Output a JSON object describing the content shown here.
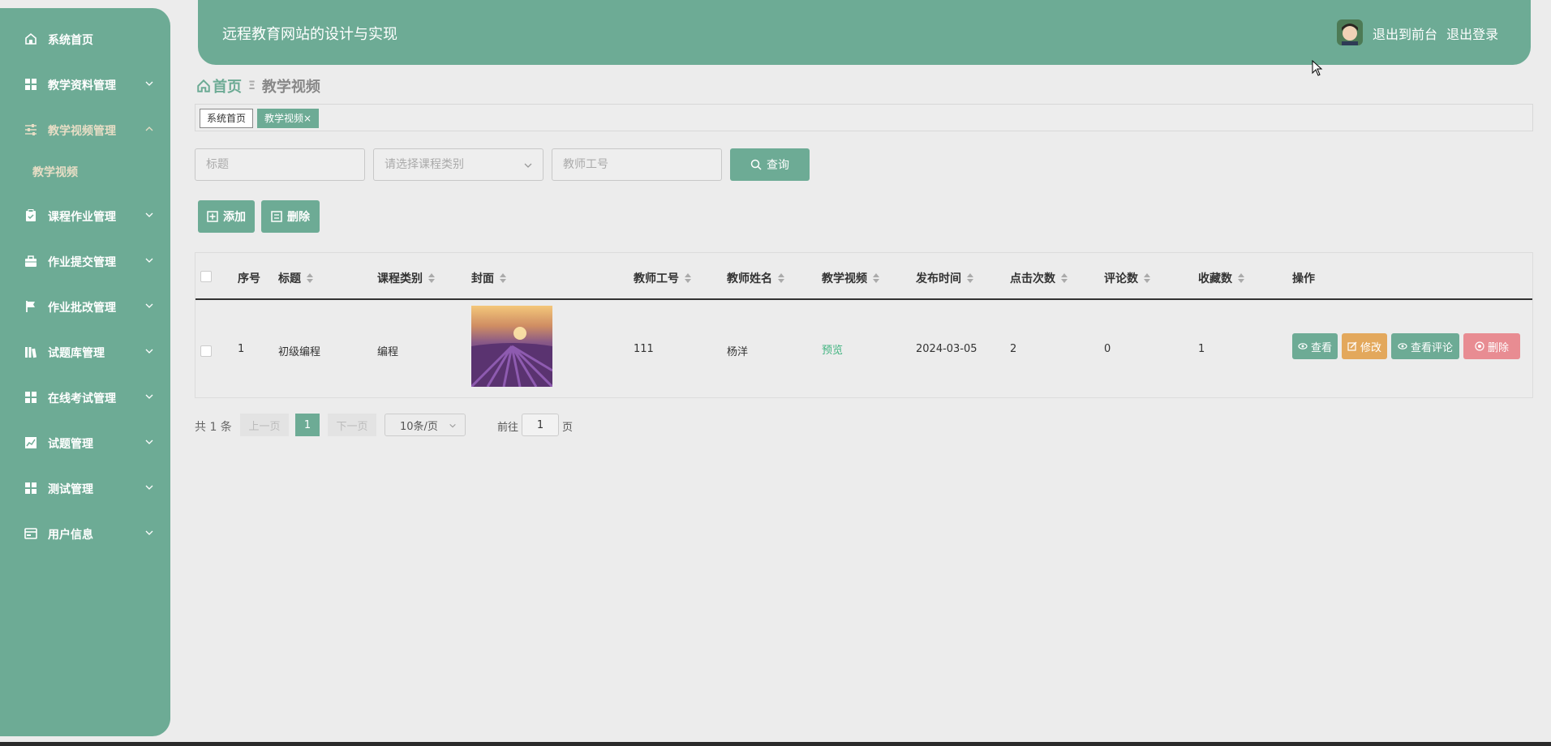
{
  "sidebar": {
    "items": [
      {
        "label": "系统首页",
        "icon": "home-icon"
      },
      {
        "label": "教学资料管理",
        "icon": "grid-icon"
      },
      {
        "label": "教学视频管理",
        "icon": "sliders-icon"
      },
      {
        "label": "课程作业管理",
        "icon": "clipboard-icon"
      },
      {
        "label": "作业提交管理",
        "icon": "briefcase-icon"
      },
      {
        "label": "作业批改管理",
        "icon": "flag-icon"
      },
      {
        "label": "试题库管理",
        "icon": "library-icon"
      },
      {
        "label": "在线考试管理",
        "icon": "grid-icon"
      },
      {
        "label": "试题管理",
        "icon": "chart-icon"
      },
      {
        "label": "测试管理",
        "icon": "grid-icon"
      },
      {
        "label": "用户信息",
        "icon": "card-icon"
      }
    ],
    "sub_item": "教学视频"
  },
  "header": {
    "title": "远程教育网站的设计与实现",
    "link_front": "退出到前台",
    "link_logout": "退出登录"
  },
  "breadcrumb": {
    "home": "首页",
    "current": "教学视频"
  },
  "tabs": {
    "home": "系统首页",
    "current": "教学视频",
    "close": "×"
  },
  "search": {
    "title_placeholder": "标题",
    "category_placeholder": "请选择课程类别",
    "teacher_placeholder": "教师工号",
    "query_label": "查询"
  },
  "toolbar": {
    "add_label": "添加",
    "delete_label": "删除"
  },
  "table": {
    "headers": [
      "序号",
      "标题",
      "课程类别",
      "封面",
      "教师工号",
      "教师姓名",
      "教学视频",
      "发布时间",
      "点击次数",
      "评论数",
      "收藏数",
      "操作"
    ],
    "rows": [
      {
        "index": "1",
        "title": "初级编程",
        "category": "编程",
        "teacher_id": "111",
        "teacher_name": "杨洋",
        "video": "预览",
        "date": "2024-03-05",
        "clicks": "2",
        "comments": "0",
        "favorites": "1"
      }
    ],
    "actions": {
      "view": "查看",
      "edit": "修改",
      "view_comments": "查看评论",
      "delete": "删除"
    }
  },
  "pagination": {
    "total": "共 1 条",
    "prev": "上一页",
    "current": "1",
    "next": "下一页",
    "page_size": "10条/页",
    "goto_label": "前往",
    "goto_value": "1",
    "goto_unit": "页"
  },
  "colors": {
    "primary": "#6dab95",
    "warning": "#e3a85c",
    "danger": "#e88c92",
    "link": "#3fb37f"
  }
}
